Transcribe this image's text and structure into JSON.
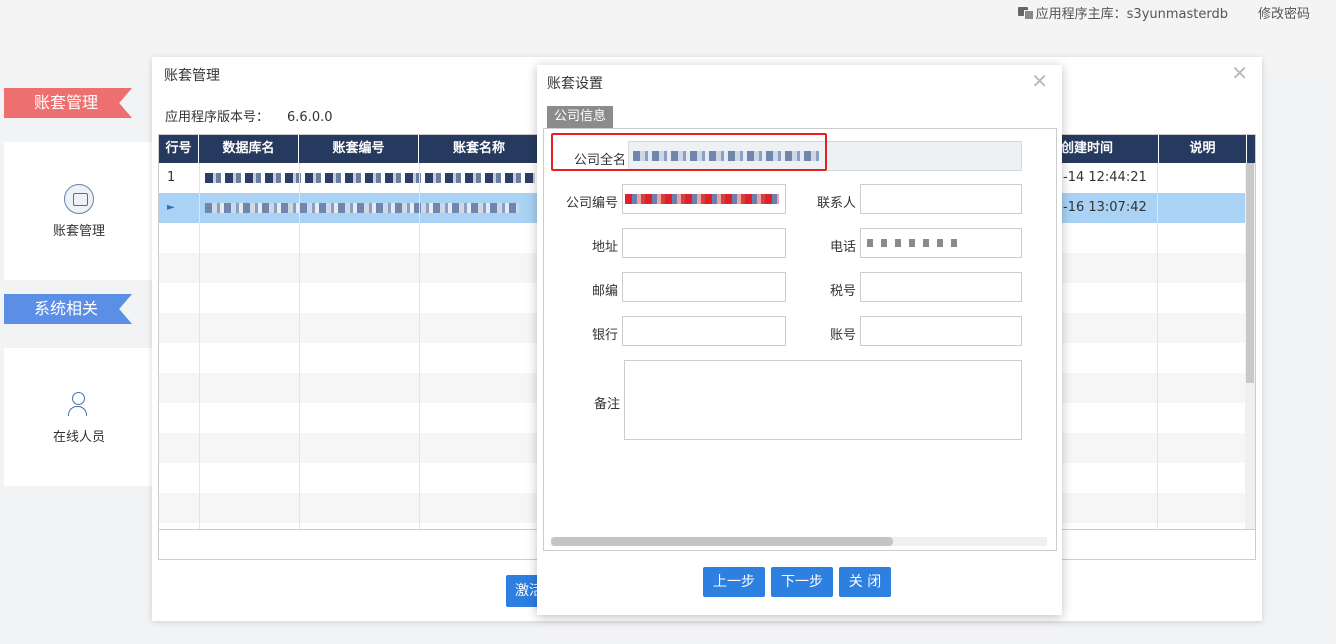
{
  "topbar": {
    "db_label": "应用程序主库：s3yunmasterdb",
    "change_password": "修改密码"
  },
  "nav": {
    "section1": "账套管理",
    "item1": "账套管理",
    "section2": "系统相关",
    "item2": "在线人员"
  },
  "back_window": {
    "title": "账套管理",
    "version_label": "应用程序版本号：",
    "version_value": "6.6.0.0",
    "columns": [
      "行号",
      "数据库名",
      "账套编号",
      "账套名称",
      "创建时间",
      "说明"
    ],
    "rows": [
      {
        "index": "1",
        "created": "-14 12:44:21"
      },
      {
        "index": "►",
        "created": "-16 13:07:42"
      }
    ],
    "activate_button": "激活"
  },
  "dialog": {
    "title": "账套设置",
    "tab": "公司信息",
    "fields": {
      "company_name": "公司全名",
      "company_code": "公司编号",
      "contact": "联系人",
      "address": "地址",
      "phone": "电话",
      "postcode": "邮编",
      "tax_no": "税号",
      "bank": "银行",
      "account": "账号",
      "remark": "备注"
    },
    "buttons": {
      "prev": "上一步",
      "next": "下一步",
      "close": "关 闭"
    }
  },
  "colors": {
    "header_bg": "#253a5e",
    "selected_row": "#a9d2f4",
    "primary_button": "#2d7fe0",
    "highlight": "#e81f1f"
  }
}
